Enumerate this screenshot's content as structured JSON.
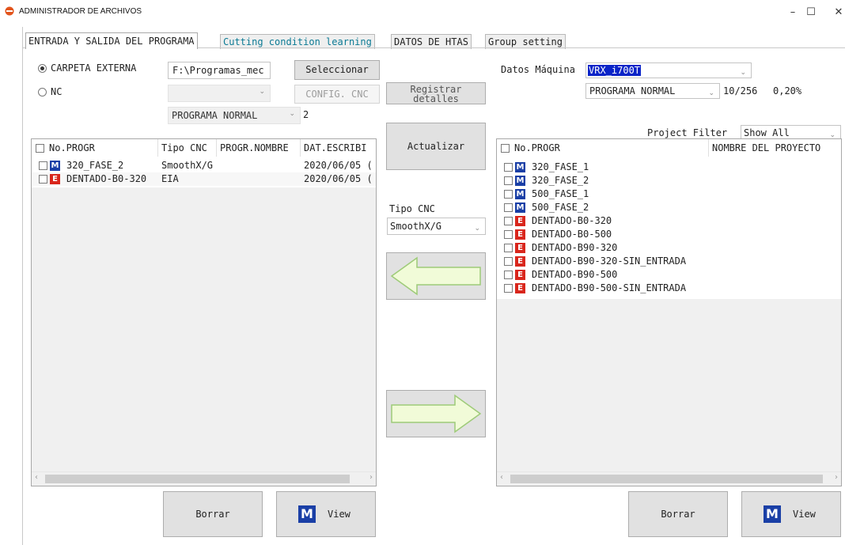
{
  "window": {
    "title": "ADMINISTRADOR DE ARCHIVOS",
    "minimize": "–",
    "maximize": "☐",
    "close": "✕"
  },
  "tabs": [
    {
      "label": "ENTRADA Y SALIDA DEL PROGRAMA",
      "active": true
    },
    {
      "label": "Cutting condition learning",
      "active": false
    },
    {
      "label": "DATOS DE HTAS",
      "active": false
    },
    {
      "label": "Group setting",
      "active": false
    }
  ],
  "source": {
    "external_folder_label": "CARPETA EXTERNA",
    "nc_label": "NC",
    "path_value": "F:\\Programas_mec",
    "select_button": "Seleccionar",
    "config_button": "CONFIG. CNC",
    "program_type": "PROGRAMA NORMAL",
    "count": "2"
  },
  "register_button": "Registrar detalles",
  "machine": {
    "label": "Datos Máquina",
    "selected": "VRX_i700T",
    "program_type": "PROGRAMA NORMAL",
    "usage": "10/256",
    "percent": "0,20%"
  },
  "left_list": {
    "columns": [
      "No.PROGR",
      "Tipo CNC",
      "PROGR.NOMBRE",
      "DAT.ESCRIBI"
    ],
    "rows": [
      {
        "icon": "M",
        "name": "320_FASE_2",
        "type": "SmoothX/G",
        "progname": "",
        "date": "2020/06/05 (",
        "highlighted": false
      },
      {
        "icon": "E",
        "name": "DENTADO-B0-320",
        "type": "EIA",
        "progname": "",
        "date": "2020/06/05 (",
        "highlighted": true
      }
    ]
  },
  "middle": {
    "update_button": "Actualizar",
    "cnc_type_label": "Tipo CNC",
    "cnc_type_value": "SmoothX/G"
  },
  "right_list": {
    "filter_label": "Project Filter",
    "filter_value": "Show All",
    "columns": [
      "No.PROGR",
      "NOMBRE DEL PROYECTO"
    ],
    "rows": [
      {
        "icon": "M",
        "name": "320_FASE_1"
      },
      {
        "icon": "M",
        "name": "320_FASE_2"
      },
      {
        "icon": "M",
        "name": "500_FASE_1"
      },
      {
        "icon": "M",
        "name": "500_FASE_2"
      },
      {
        "icon": "E",
        "name": "DENTADO-B0-320"
      },
      {
        "icon": "E",
        "name": "DENTADO-B0-500"
      },
      {
        "icon": "E",
        "name": "DENTADO-B90-320"
      },
      {
        "icon": "E",
        "name": "DENTADO-B90-320-SIN_ENTRADA"
      },
      {
        "icon": "E",
        "name": "DENTADO-B90-500"
      },
      {
        "icon": "E",
        "name": "DENTADO-B90-500-SIN_ENTRADA"
      }
    ]
  },
  "bottom": {
    "delete_label": "Borrar",
    "view_label": "View",
    "view_icon": "M"
  },
  "colors": {
    "selection": "#0a24c8",
    "arrow_fill": "#f1fbd8",
    "arrow_stroke": "#9ecb78",
    "m_icon": "#1a3fa6",
    "e_icon": "#d9261c"
  }
}
